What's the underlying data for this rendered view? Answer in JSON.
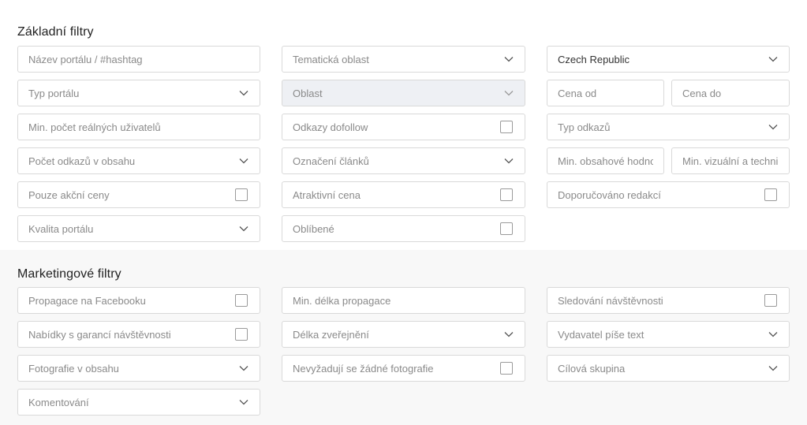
{
  "basic": {
    "title": "Základní filtry",
    "portal_name": {
      "placeholder": "Název portálu / #hashtag"
    },
    "thematic_area": {
      "label": "Tematická oblast"
    },
    "country": {
      "label": "Czech Republic"
    },
    "portal_type": {
      "label": "Typ portálu"
    },
    "area": {
      "label": "Oblast"
    },
    "price_from": {
      "placeholder": "Cena od"
    },
    "price_to": {
      "placeholder": "Cena do"
    },
    "min_users": {
      "placeholder": "Min. počet reálných uživatelů"
    },
    "dofollow": {
      "label": "Odkazy dofollow"
    },
    "link_type": {
      "label": "Typ odkazů"
    },
    "links_in_content": {
      "label": "Počet odkazů v obsahu"
    },
    "article_marking": {
      "label": "Označení článků"
    },
    "min_content_rating": {
      "placeholder": "Min. obsahové hodnocení"
    },
    "min_visual_rating": {
      "placeholder": "Min. vizuální a technické hodnocení"
    },
    "only_sale_prices": {
      "label": "Pouze akční ceny"
    },
    "attractive_price": {
      "label": "Atraktivní cena"
    },
    "recommended": {
      "label": "Doporučováno redakcí"
    },
    "portal_quality": {
      "label": "Kvalita portálu"
    },
    "favorite": {
      "label": "Oblíbené"
    }
  },
  "marketing": {
    "title": "Marketingové filtry",
    "facebook_promo": {
      "label": "Propagace na Facebooku"
    },
    "min_promo_length": {
      "placeholder": "Min. délka propagace"
    },
    "traffic_tracking": {
      "label": "Sledování návštěvnosti"
    },
    "guaranteed_traffic": {
      "label": "Nabídky s garancí návštěvnosti"
    },
    "publish_length": {
      "label": "Délka zveřejnění"
    },
    "publisher_writes": {
      "label": "Vydavatel píše text"
    },
    "photos_in_content": {
      "label": "Fotografie v obsahu"
    },
    "no_photos_required": {
      "label": "Nevyžadují se žádné fotografie"
    },
    "target_group": {
      "label": "Cílová skupina"
    },
    "comments": {
      "label": "Komentování"
    }
  },
  "colors": {
    "border": "#d9d9d9",
    "placeholder": "#8a8a8a",
    "disabled_bg": "#eef0f4",
    "marketing_bg": "#f8f8f8"
  }
}
